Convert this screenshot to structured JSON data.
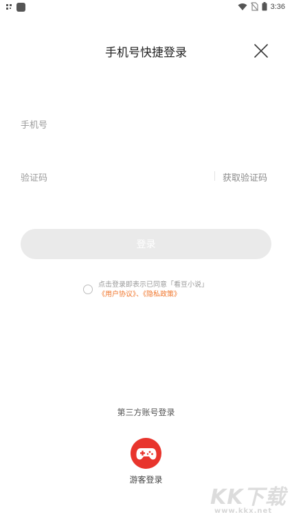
{
  "status_bar": {
    "time": "3:36",
    "icons": [
      "qr-icon",
      "app-icon",
      "wifi-icon",
      "no-sim-icon",
      "battery-icon"
    ]
  },
  "header": {
    "title": "手机号快捷登录",
    "close_icon": "close-icon"
  },
  "form": {
    "phone_placeholder": "手机号",
    "code_placeholder": "验证码",
    "get_code_label": "获取验证码",
    "login_label": "登录"
  },
  "agreement": {
    "text": "点击登录即表示已同意「看豆小说」",
    "user_agreement": "《用户协议》",
    "separator": "、",
    "privacy_policy": "《隐私政策》"
  },
  "third_party": {
    "title": "第三方账号登录",
    "guest_label": "游客登录",
    "guest_icon": "gamepad-icon"
  },
  "watermark": {
    "big": "KK下载",
    "small": "www.kkx.net"
  },
  "colors": {
    "accent": "#f0762c",
    "guest_button": "#e8352d",
    "login_button_disabled": "#eaeaea"
  }
}
